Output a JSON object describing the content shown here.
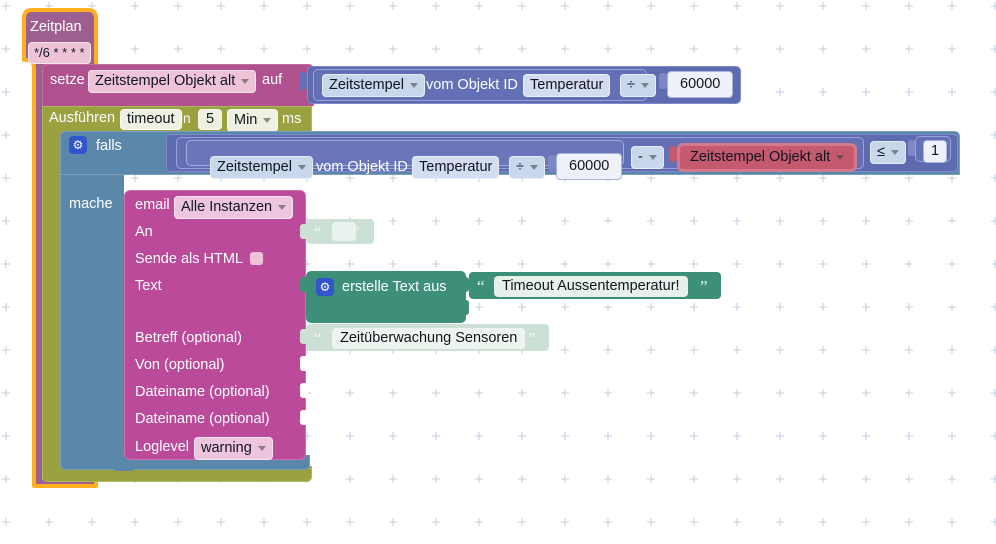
{
  "editor": {
    "name": "blockly-script-editor",
    "background": "#ffffff",
    "grid_dot_color": "#c5d2e2"
  },
  "colors": {
    "schedule": "#9d5f8f",
    "schedule_highlight": "#ffb020",
    "set_var": "#b0528f",
    "timeout": "#9aa23f",
    "control": "#5b87ab",
    "logic_blue": "#5f6bb0",
    "value_blue": "#6470b5",
    "email_magenta": "#bb4a9b",
    "text_green": "#3e8f77",
    "text_green_pale": "#cde0d5",
    "var_rose": "#c4596f",
    "gear_badge": "#3355cc"
  },
  "blocks": {
    "schedule": {
      "title": "Zeitplan",
      "cron": "*/6 * * * *"
    },
    "set_variable": {
      "keyword": "setze",
      "variable": "Zeitstempel Objekt alt",
      "connector": "auf"
    },
    "set_value_expr": {
      "selector": "Zeitstempel",
      "middle": "vom Objekt ID",
      "object_id": "Temperatur",
      "operator": "÷",
      "operand": "60000"
    },
    "timeout": {
      "keyword": "Ausführen",
      "name": "timeout",
      "in": "in",
      "amount": "5",
      "unit": "Min",
      "suffix": "ms"
    },
    "if_block": {
      "keyword": "falls",
      "do_keyword": "mache",
      "gear_icon": "gear-icon"
    },
    "condition": {
      "selector": "Zeitstempel",
      "middle": "vom Objekt ID",
      "object_id": "Temperatur",
      "operator1": "÷",
      "operand1": "60000",
      "operator2": "-",
      "variable": "Zeitstempel Objekt alt",
      "compare_operator": "≤",
      "compare_value": "1"
    },
    "email": {
      "keyword": "email",
      "instance": "Alle Instanzen",
      "rows": [
        {
          "label": "An",
          "value_type": "text-empty"
        },
        {
          "label": "Sende als HTML",
          "value_type": "checkbox"
        },
        {
          "label": "Text",
          "value_type": "create-text"
        },
        {
          "label": "Betreff (optional)",
          "value_type": "text"
        },
        {
          "label": "Von (optional)",
          "value_type": "empty"
        },
        {
          "label": "Dateiname (optional)",
          "value_type": "empty"
        },
        {
          "label": "Dateiname (optional)",
          "value_type": "empty"
        }
      ],
      "loglevel_label": "Loglevel",
      "loglevel_value": "warning"
    },
    "create_text": {
      "keyword": "erstelle Text aus",
      "gear_icon": "gear-icon"
    },
    "text_values": {
      "empty_text": "",
      "timeout_text": "Timeout Aussentemperatur!",
      "subject_text": "Zeitüberwachung Sensoren",
      "open_quote": "“",
      "close_quote": "”"
    }
  }
}
